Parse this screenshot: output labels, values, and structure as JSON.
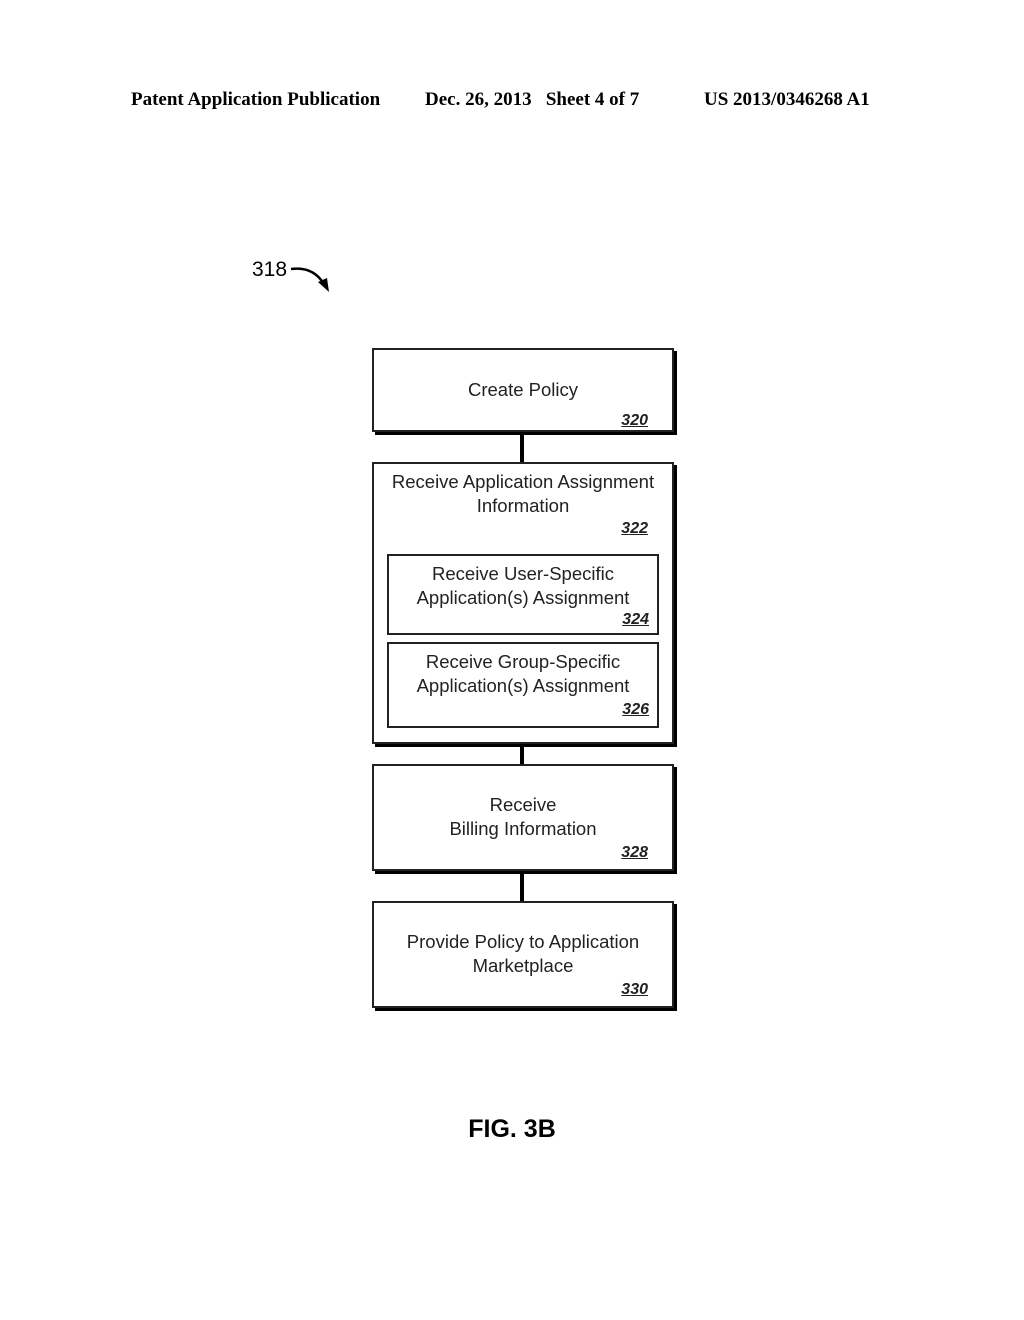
{
  "header": {
    "publication": "Patent Application Publication",
    "date_sheet": "Dec. 26, 2013   Sheet 4 of 7",
    "patent_number": "US 2013/0346268 A1"
  },
  "diagram": {
    "reference": "318",
    "steps": [
      {
        "label_lines": [
          "Create Policy"
        ],
        "number": "320"
      },
      {
        "label_lines": [
          "Receive Application Assignment",
          "Information"
        ],
        "number": "322",
        "substeps": [
          {
            "label_lines": [
              "Receive User-Specific",
              "Application(s) Assignment"
            ],
            "number": "324"
          },
          {
            "label_lines": [
              "Receive Group-Specific",
              "Application(s) Assignment"
            ],
            "number": "326"
          }
        ]
      },
      {
        "label_lines": [
          "Receive",
          "Billing Information"
        ],
        "number": "328"
      },
      {
        "label_lines": [
          "Provide Policy to Application",
          "Marketplace"
        ],
        "number": "330"
      }
    ]
  },
  "figure_label": "FIG. 3B"
}
